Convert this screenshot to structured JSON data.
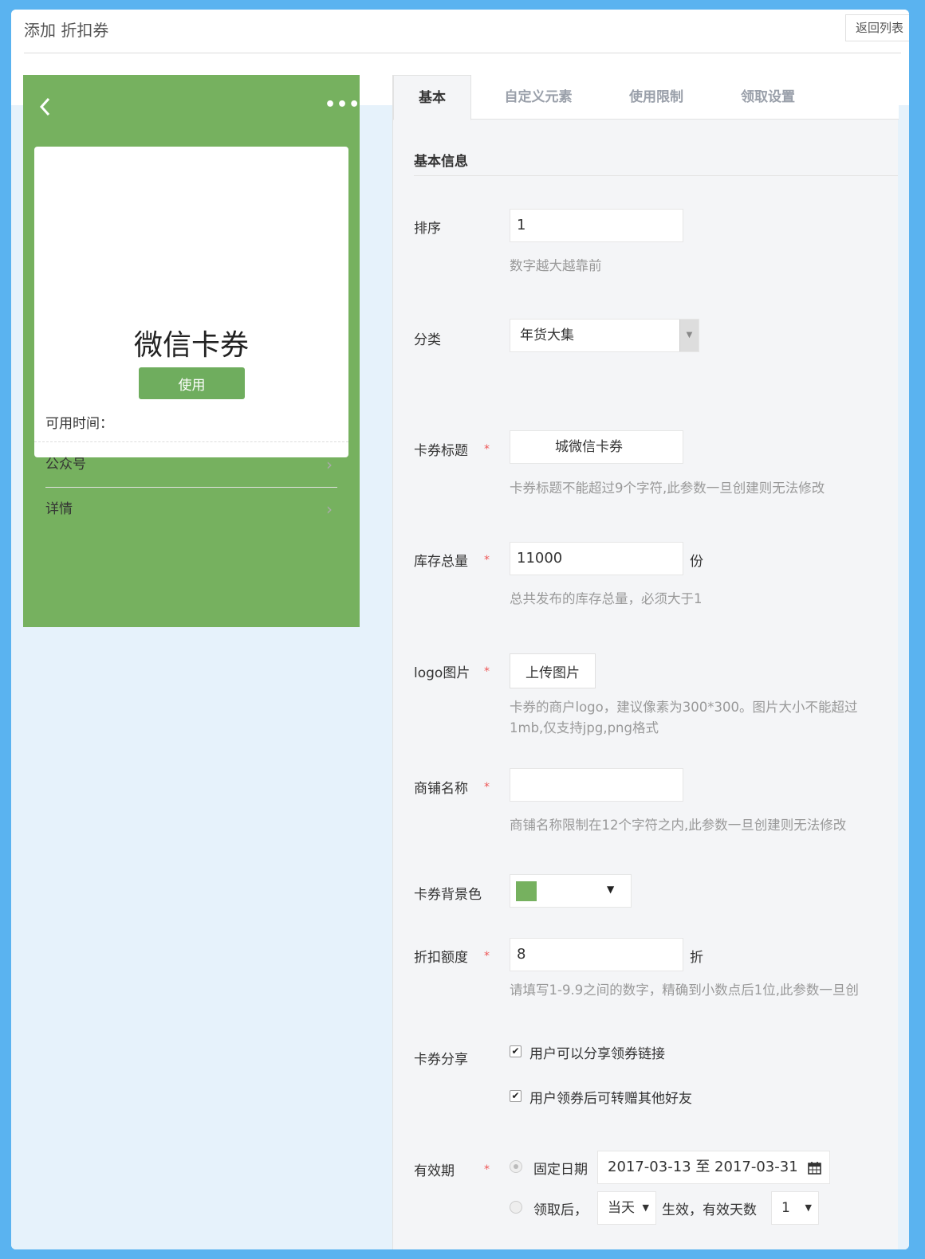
{
  "header": {
    "title": "添加 折扣券",
    "back_label": "返回列表"
  },
  "preview": {
    "card_title": "微信卡券",
    "use_button": "使用",
    "available_time_label": "可用时间：",
    "rows": [
      {
        "label": "公众号"
      },
      {
        "label": "详情"
      }
    ],
    "bg_color": "#76b15f"
  },
  "tabs": [
    {
      "label": "基本",
      "active": true
    },
    {
      "label": "自定义元素"
    },
    {
      "label": "使用限制"
    },
    {
      "label": "领取设置"
    }
  ],
  "form": {
    "section_title": "基本信息",
    "sort": {
      "label": "排序",
      "value": "1",
      "help": "数字越大越靠前"
    },
    "category": {
      "label": "分类",
      "value": "年货大集"
    },
    "card_title": {
      "label": "卡券标题",
      "value": "城微信卡券",
      "help": "卡券标题不能超过9个字符,此参数一旦创建则无法修改"
    },
    "stock": {
      "label": "库存总量",
      "value": "11000",
      "unit": "份",
      "help": "总共发布的库存总量，必须大于1"
    },
    "logo": {
      "label": "logo图片",
      "button": "上传图片",
      "help_line1": "卡券的商户logo，建议像素为300*300。图片大小不能超过",
      "help_line2": "1mb,仅支持jpg,png格式"
    },
    "shop_name": {
      "label": "商铺名称",
      "value": "",
      "help": "商铺名称限制在12个字符之内,此参数一旦创建则无法修改"
    },
    "bg_color": {
      "label": "卡券背景色",
      "value": "#76b15f"
    },
    "discount": {
      "label": "折扣额度",
      "value": "8",
      "unit": "折",
      "help": "请填写1-9.9之间的数字，精确到小数点后1位,此参数一旦创"
    },
    "share": {
      "label": "卡券分享",
      "option1": "用户可以分享领券链接",
      "option2": "用户领券后可转赠其他好友"
    },
    "validity": {
      "label": "有效期",
      "fixed_label": "固定日期",
      "date_range": "2017-03-13 至 2017-03-31",
      "after_label": "领取后，",
      "day_select": "当天",
      "effective_label": "生效，有效天数",
      "days_value": "1"
    },
    "required_mark": "*"
  }
}
